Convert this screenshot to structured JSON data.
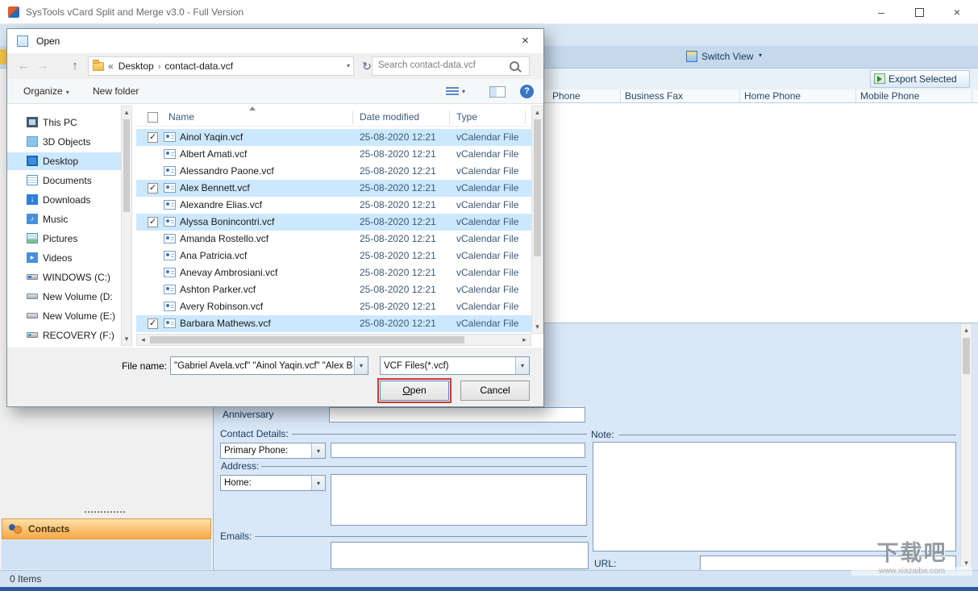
{
  "window": {
    "title": "SysTools vCard Split and Merge v3.0 - Full Version"
  },
  "app": {
    "switch_view_label": "Switch View",
    "export_selected_label": "Export Selected",
    "columns": [
      "Phone",
      "Business Fax",
      "Home Phone",
      "Mobile Phone"
    ],
    "contacts_panel_label": "Contacts",
    "status_text": "0 Items",
    "form": {
      "anniversary_label": "Anniversary",
      "contact_details_label": "Contact Details:",
      "primary_phone_value": "Primary Phone:",
      "address_label": "Address:",
      "home_value": "Home:",
      "emails_label": "Emails:",
      "note_label": "Note:",
      "url_label": "URL:"
    }
  },
  "dialog": {
    "title": "Open",
    "nav": {
      "breadcrumb_items": [
        "Desktop",
        "contact-data.vcf"
      ],
      "search_placeholder": "Search contact-data.vcf"
    },
    "toolbar": {
      "organize_label": "Organize",
      "new_folder_label": "New folder"
    },
    "sidebar_items": [
      {
        "label": "This PC",
        "icon": "pc",
        "selected": false
      },
      {
        "label": "3D Objects",
        "icon": "objects3d",
        "selected": false
      },
      {
        "label": "Desktop",
        "icon": "desktop",
        "selected": true
      },
      {
        "label": "Documents",
        "icon": "documents",
        "selected": false
      },
      {
        "label": "Downloads",
        "icon": "downloads",
        "selected": false
      },
      {
        "label": "Music",
        "icon": "music",
        "selected": false
      },
      {
        "label": "Pictures",
        "icon": "pictures",
        "selected": false
      },
      {
        "label": "Videos",
        "icon": "videos",
        "selected": false
      },
      {
        "label": "WINDOWS (C:)",
        "icon": "drive-c",
        "selected": false
      },
      {
        "label": "New Volume (D:",
        "icon": "drive",
        "selected": false
      },
      {
        "label": "New Volume (E:)",
        "icon": "drive",
        "selected": false
      },
      {
        "label": "RECOVERY (F:)",
        "icon": "drive-recovery",
        "selected": false
      }
    ],
    "file_list": {
      "columns": [
        "Name",
        "Date modified",
        "Type"
      ],
      "rows": [
        {
          "name": "Ainol Yaqin.vcf",
          "date_modified": "25-08-2020 12:21",
          "type": "vCalendar File",
          "checked": true
        },
        {
          "name": "Albert Amati.vcf",
          "date_modified": "25-08-2020 12:21",
          "type": "vCalendar File",
          "checked": false
        },
        {
          "name": "Alessandro Paone.vcf",
          "date_modified": "25-08-2020 12:21",
          "type": "vCalendar File",
          "checked": false
        },
        {
          "name": "Alex Bennett.vcf",
          "date_modified": "25-08-2020 12:21",
          "type": "vCalendar File",
          "checked": true
        },
        {
          "name": "Alexandre Elias.vcf",
          "date_modified": "25-08-2020 12:21",
          "type": "vCalendar File",
          "checked": false
        },
        {
          "name": "Alyssa Bonincontri.vcf",
          "date_modified": "25-08-2020 12:21",
          "type": "vCalendar File",
          "checked": true
        },
        {
          "name": "Amanda Rostello.vcf",
          "date_modified": "25-08-2020 12:21",
          "type": "vCalendar File",
          "checked": false
        },
        {
          "name": "Ana Patricia.vcf",
          "date_modified": "25-08-2020 12:21",
          "type": "vCalendar File",
          "checked": false
        },
        {
          "name": "Anevay Ambrosiani.vcf",
          "date_modified": "25-08-2020 12:21",
          "type": "vCalendar File",
          "checked": false
        },
        {
          "name": "Ashton Parker.vcf",
          "date_modified": "25-08-2020 12:21",
          "type": "vCalendar File",
          "checked": false
        },
        {
          "name": "Avery Robinson.vcf",
          "date_modified": "25-08-2020 12:21",
          "type": "vCalendar File",
          "checked": false
        },
        {
          "name": "Barbara Mathews.vcf",
          "date_modified": "25-08-2020 12:21",
          "type": "vCalendar File",
          "checked": true
        }
      ]
    },
    "footer": {
      "file_name_label": "File name:",
      "file_name_value": "\"Gabriel Avela.vcf\" \"Ainol Yaqin.vcf\" \"Alex Be",
      "file_type_value": "VCF Files(*.vcf)",
      "open_label": "Open",
      "cancel_label": "Cancel"
    }
  },
  "watermark": {
    "text": "下载吧",
    "url": "www.xiazaiba.com"
  },
  "icons": {
    "minimize": "–",
    "close": "×",
    "back": "←",
    "forward": "→",
    "up": "↑",
    "refresh": "↻",
    "dropdown": "▾",
    "breadcrumb_overflow": "«",
    "breadcrumb_separator": "›",
    "help": "?",
    "scroll_up": "▴",
    "scroll_down": "▾",
    "scroll_left": "◂",
    "scroll_right": "▸"
  },
  "colors": {
    "selection": "#cce8ff",
    "open_button_highlight": "#cf3a35",
    "band_blue": "#c6d9ec",
    "form_panel_blue": "#d9e7f7",
    "contacts_orange": "#f8a944",
    "label_navy": "#17395f"
  }
}
